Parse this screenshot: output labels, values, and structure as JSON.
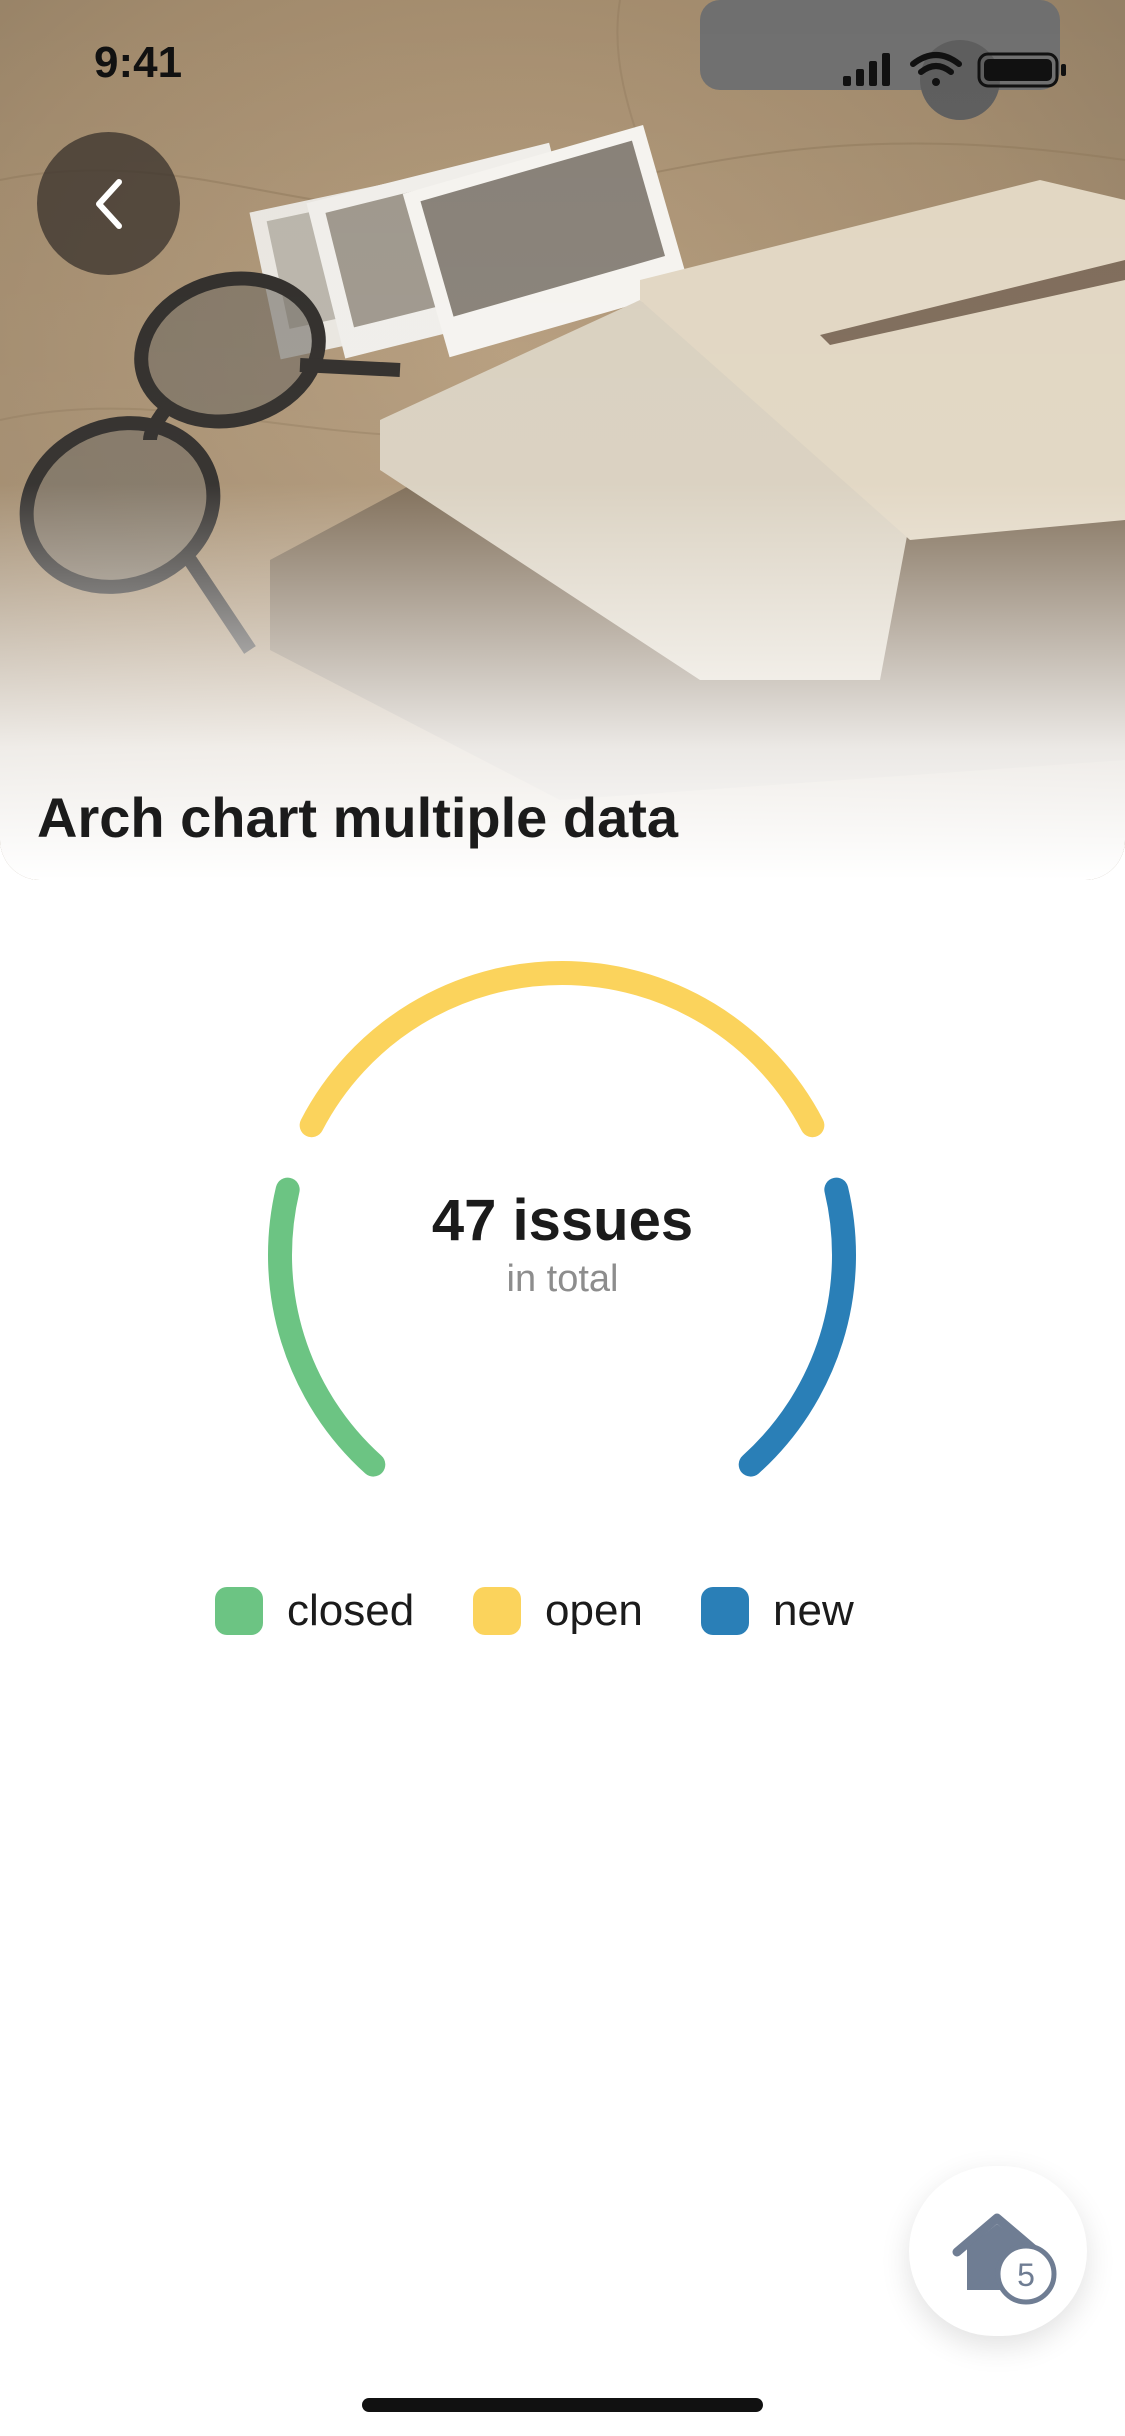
{
  "status_bar": {
    "time": "9:41"
  },
  "header": {
    "title": "Arch chart multiple data",
    "back_icon": "chevron-left-icon"
  },
  "chart_data": {
    "type": "arch",
    "segments": [
      {
        "name": "closed",
        "color": "#6cc483",
        "share": 0.26
      },
      {
        "name": "open",
        "color": "#fbd35c",
        "share": 0.48
      },
      {
        "name": "new",
        "color": "#2a7fb7",
        "share": 0.26
      }
    ],
    "center": {
      "value": "47 issues",
      "caption": "in total"
    }
  },
  "legend": {
    "items": [
      {
        "label": "closed",
        "color": "#6cc483"
      },
      {
        "label": "open",
        "color": "#fbd35c"
      },
      {
        "label": "new",
        "color": "#2a7fb7"
      }
    ]
  },
  "fab": {
    "icon": "home-icon",
    "badge": "5"
  }
}
